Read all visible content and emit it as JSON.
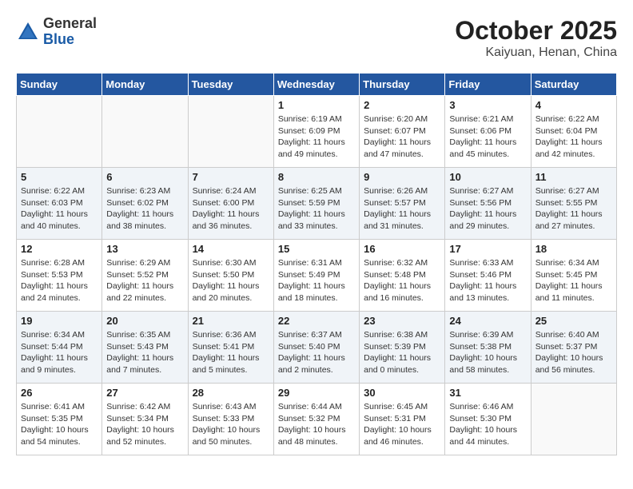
{
  "header": {
    "logo_general": "General",
    "logo_blue": "Blue",
    "title": "October 2025",
    "subtitle": "Kaiyuan, Henan, China"
  },
  "weekdays": [
    "Sunday",
    "Monday",
    "Tuesday",
    "Wednesday",
    "Thursday",
    "Friday",
    "Saturday"
  ],
  "weeks": [
    [
      {
        "day": "",
        "info": ""
      },
      {
        "day": "",
        "info": ""
      },
      {
        "day": "",
        "info": ""
      },
      {
        "day": "1",
        "info": "Sunrise: 6:19 AM\nSunset: 6:09 PM\nDaylight: 11 hours\nand 49 minutes."
      },
      {
        "day": "2",
        "info": "Sunrise: 6:20 AM\nSunset: 6:07 PM\nDaylight: 11 hours\nand 47 minutes."
      },
      {
        "day": "3",
        "info": "Sunrise: 6:21 AM\nSunset: 6:06 PM\nDaylight: 11 hours\nand 45 minutes."
      },
      {
        "day": "4",
        "info": "Sunrise: 6:22 AM\nSunset: 6:04 PM\nDaylight: 11 hours\nand 42 minutes."
      }
    ],
    [
      {
        "day": "5",
        "info": "Sunrise: 6:22 AM\nSunset: 6:03 PM\nDaylight: 11 hours\nand 40 minutes."
      },
      {
        "day": "6",
        "info": "Sunrise: 6:23 AM\nSunset: 6:02 PM\nDaylight: 11 hours\nand 38 minutes."
      },
      {
        "day": "7",
        "info": "Sunrise: 6:24 AM\nSunset: 6:00 PM\nDaylight: 11 hours\nand 36 minutes."
      },
      {
        "day": "8",
        "info": "Sunrise: 6:25 AM\nSunset: 5:59 PM\nDaylight: 11 hours\nand 33 minutes."
      },
      {
        "day": "9",
        "info": "Sunrise: 6:26 AM\nSunset: 5:57 PM\nDaylight: 11 hours\nand 31 minutes."
      },
      {
        "day": "10",
        "info": "Sunrise: 6:27 AM\nSunset: 5:56 PM\nDaylight: 11 hours\nand 29 minutes."
      },
      {
        "day": "11",
        "info": "Sunrise: 6:27 AM\nSunset: 5:55 PM\nDaylight: 11 hours\nand 27 minutes."
      }
    ],
    [
      {
        "day": "12",
        "info": "Sunrise: 6:28 AM\nSunset: 5:53 PM\nDaylight: 11 hours\nand 24 minutes."
      },
      {
        "day": "13",
        "info": "Sunrise: 6:29 AM\nSunset: 5:52 PM\nDaylight: 11 hours\nand 22 minutes."
      },
      {
        "day": "14",
        "info": "Sunrise: 6:30 AM\nSunset: 5:50 PM\nDaylight: 11 hours\nand 20 minutes."
      },
      {
        "day": "15",
        "info": "Sunrise: 6:31 AM\nSunset: 5:49 PM\nDaylight: 11 hours\nand 18 minutes."
      },
      {
        "day": "16",
        "info": "Sunrise: 6:32 AM\nSunset: 5:48 PM\nDaylight: 11 hours\nand 16 minutes."
      },
      {
        "day": "17",
        "info": "Sunrise: 6:33 AM\nSunset: 5:46 PM\nDaylight: 11 hours\nand 13 minutes."
      },
      {
        "day": "18",
        "info": "Sunrise: 6:34 AM\nSunset: 5:45 PM\nDaylight: 11 hours\nand 11 minutes."
      }
    ],
    [
      {
        "day": "19",
        "info": "Sunrise: 6:34 AM\nSunset: 5:44 PM\nDaylight: 11 hours\nand 9 minutes."
      },
      {
        "day": "20",
        "info": "Sunrise: 6:35 AM\nSunset: 5:43 PM\nDaylight: 11 hours\nand 7 minutes."
      },
      {
        "day": "21",
        "info": "Sunrise: 6:36 AM\nSunset: 5:41 PM\nDaylight: 11 hours\nand 5 minutes."
      },
      {
        "day": "22",
        "info": "Sunrise: 6:37 AM\nSunset: 5:40 PM\nDaylight: 11 hours\nand 2 minutes."
      },
      {
        "day": "23",
        "info": "Sunrise: 6:38 AM\nSunset: 5:39 PM\nDaylight: 11 hours\nand 0 minutes."
      },
      {
        "day": "24",
        "info": "Sunrise: 6:39 AM\nSunset: 5:38 PM\nDaylight: 10 hours\nand 58 minutes."
      },
      {
        "day": "25",
        "info": "Sunrise: 6:40 AM\nSunset: 5:37 PM\nDaylight: 10 hours\nand 56 minutes."
      }
    ],
    [
      {
        "day": "26",
        "info": "Sunrise: 6:41 AM\nSunset: 5:35 PM\nDaylight: 10 hours\nand 54 minutes."
      },
      {
        "day": "27",
        "info": "Sunrise: 6:42 AM\nSunset: 5:34 PM\nDaylight: 10 hours\nand 52 minutes."
      },
      {
        "day": "28",
        "info": "Sunrise: 6:43 AM\nSunset: 5:33 PM\nDaylight: 10 hours\nand 50 minutes."
      },
      {
        "day": "29",
        "info": "Sunrise: 6:44 AM\nSunset: 5:32 PM\nDaylight: 10 hours\nand 48 minutes."
      },
      {
        "day": "30",
        "info": "Sunrise: 6:45 AM\nSunset: 5:31 PM\nDaylight: 10 hours\nand 46 minutes."
      },
      {
        "day": "31",
        "info": "Sunrise: 6:46 AM\nSunset: 5:30 PM\nDaylight: 10 hours\nand 44 minutes."
      },
      {
        "day": "",
        "info": ""
      }
    ]
  ]
}
